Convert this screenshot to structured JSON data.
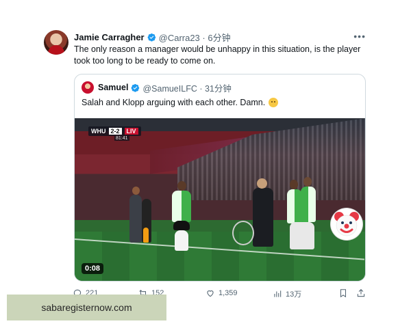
{
  "tweet": {
    "author_name": "Jamie Carragher",
    "handle_time": "@Carra23 · 6分钟",
    "text": "The only reason a manager would be unhappy in this situation, is the player took too long to be ready to come on.",
    "more_icon": "more-icon"
  },
  "quote": {
    "author_name": "Samuel",
    "handle_time": "@SamueILFC · 31分钟",
    "text": "Salah and Klopp arguing with each other. Damn.",
    "emoji": "grimacing-face-emoji"
  },
  "video": {
    "scorebug": {
      "home": "WHU",
      "score": "2-2",
      "away": "LIV",
      "clock": "81:41"
    },
    "duration": "0:08",
    "overlay_emoji": "clown-face-emoji"
  },
  "actions": {
    "reply_count": "221",
    "retweet_count": "152",
    "like_count": "1,359",
    "view_count": "13万",
    "bookmark_icon": "bookmark-icon",
    "share_icon": "share-icon"
  },
  "watermark": {
    "text": "sabaregisternow.com"
  },
  "colors": {
    "verified": "#1d9bf0",
    "text_primary": "#0f1419",
    "text_secondary": "#536471",
    "border": "#cfd9de"
  }
}
